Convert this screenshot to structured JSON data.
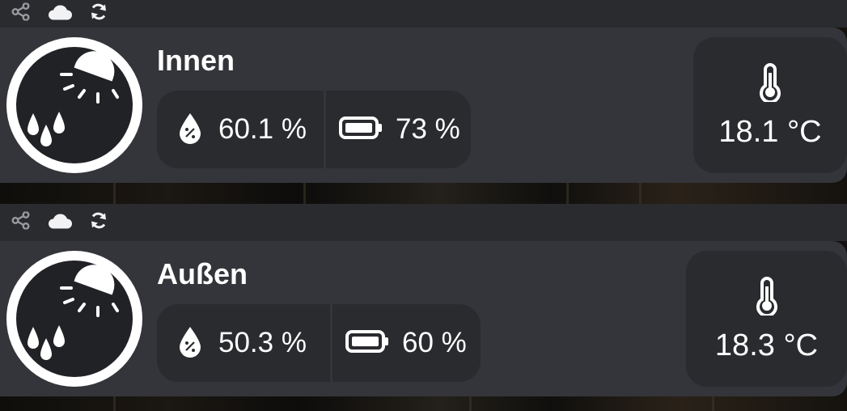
{
  "sensors": [
    {
      "name": "Innen",
      "humidity": "60.1 %",
      "battery": "73 %",
      "temperature": "18.1 °C"
    },
    {
      "name": "Außen",
      "humidity": "50.3 %",
      "battery": "60 %",
      "temperature": "18.3 °C"
    }
  ],
  "colors": {
    "card": "#34353a",
    "header": "#2a2b2f",
    "pill": "#2a2b2f",
    "text": "#ffffff"
  },
  "icons": [
    "share-icon",
    "cloud-icon",
    "refresh-icon",
    "weather-sun-rain-icon",
    "humidity-drop-icon",
    "battery-icon",
    "thermometer-icon"
  ]
}
